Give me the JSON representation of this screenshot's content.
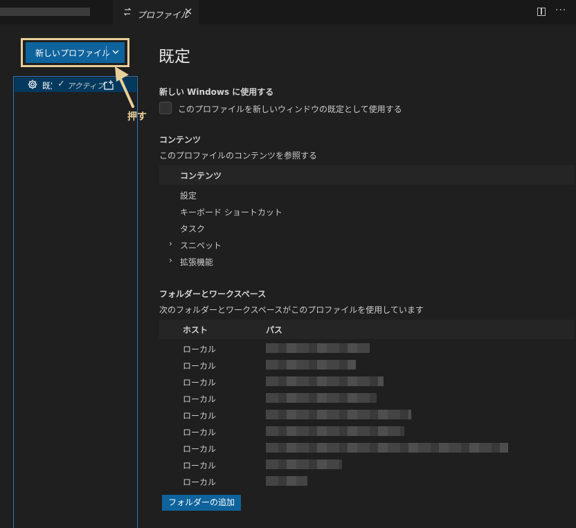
{
  "tabs": {
    "active_title": "プロファイル",
    "active_icon": "profile-switch-icon",
    "close_icon": "close-icon"
  },
  "actions": {
    "split_icon": "split-editor-icon",
    "more_icon": "more-actions-icon",
    "more_glyph": "···"
  },
  "sidebar": {
    "new_profile_label": "新しいプロファイル",
    "new_profile_dropdown_icon": "chevron-down-icon",
    "profiles": [
      {
        "name": "既定",
        "icon": "gear-icon",
        "status": "アクティブ",
        "check_glyph": "✓",
        "new_window_icon": "new-window-icon"
      }
    ]
  },
  "annotation": {
    "push_label": "押す",
    "highlight_color": "#e8cf9a"
  },
  "main": {
    "title": "既定",
    "new_windows": {
      "heading": "新しい Windows に使用する",
      "checkbox_label": "このプロファイルを新しいウィンドウの既定として使用する",
      "checked": false
    },
    "contents": {
      "heading": "コンテンツ",
      "description": "このプロファイルのコンテンツを参照する",
      "column_header": "コンテンツ",
      "items": [
        {
          "label": "設定",
          "expandable": false
        },
        {
          "label": "キーボード ショートカット",
          "expandable": false
        },
        {
          "label": "タスク",
          "expandable": false
        },
        {
          "label": "スニペット",
          "expandable": true,
          "caret": "›"
        },
        {
          "label": "拡張機能",
          "expandable": true,
          "caret": "›"
        }
      ]
    },
    "folders": {
      "heading": "フォルダーとワークスペース",
      "description": "次のフォルダーとワークスペースがこのプロファイルを使用しています",
      "columns": {
        "host": "ホスト",
        "path": "パス"
      },
      "rows": [
        {
          "host": "ローカル"
        },
        {
          "host": "ローカル"
        },
        {
          "host": "ローカル"
        },
        {
          "host": "ローカル"
        },
        {
          "host": "ローカル"
        },
        {
          "host": "ローカル"
        },
        {
          "host": "ローカル"
        },
        {
          "host": "ローカル"
        },
        {
          "host": "ローカル"
        }
      ],
      "add_button_label": "フォルダーの追加"
    }
  },
  "colors": {
    "background": "#1f1f1f",
    "accent_button": "#0e639c",
    "selection": "#04395e",
    "focus_border": "#2b79c2"
  }
}
